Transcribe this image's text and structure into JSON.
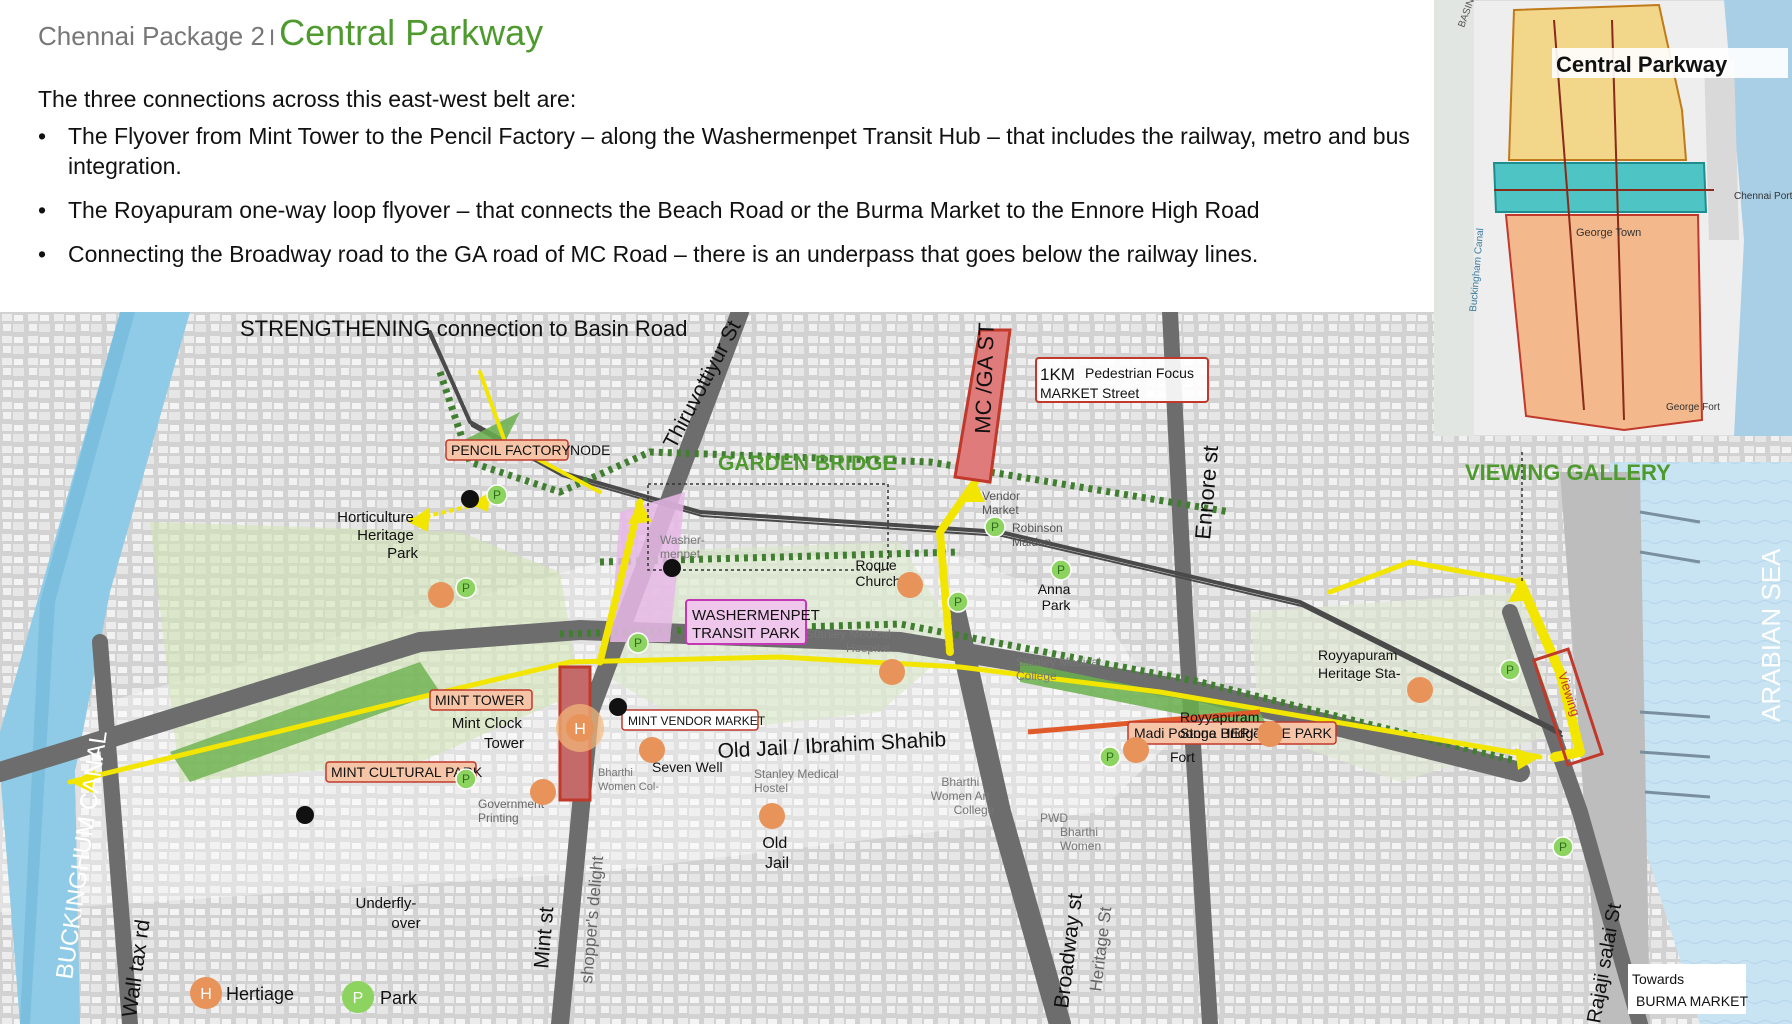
{
  "header": {
    "package": "Chennai Package 2",
    "separator": "I",
    "title": "Central Parkway"
  },
  "intro": "The three connections across this east-west belt are:",
  "bullets": [
    "The Flyover from Mint Tower to the Pencil Factory – along the Washermenpet Transit Hub –  that includes the railway, metro and bus integration.",
    "The Royapuram one-way loop flyover – that connects the Beach Road or the Burma Market to the Ennore High Road",
    "Connecting the Broadway road to the GA road of MC Road – there is an underpass that goes below the railway lines."
  ],
  "map": {
    "top_label": "STRENGTHENING connection to Basin Road",
    "roads": {
      "thiruvottiyur": "Thiruvottiyur St",
      "mc_ga": "MC /GA ST",
      "ennore": "Ennore st",
      "broadway": "Broadway st",
      "heritage_st": "Heritage St",
      "mint": "Mint  st",
      "shoppers": "shopper's delight",
      "wall_tax": "Wall tax rd",
      "rajaji": "Rajaji salai St",
      "old_jail": "Old Jail / Ibrahim Shahib"
    },
    "water": {
      "canal": "BUCKINGHUM CANAL",
      "sea": "ARABIAN SEA"
    },
    "callouts": {
      "garden_bridge": "GARDEN BRIDGE",
      "viewing_gallery": "VIEWING GALLERY",
      "viewing_vertical": "Viewing",
      "market_street_km": "1KM",
      "market_street_1": "Pedestrian Focus",
      "market_street_2": "MARKET Street",
      "pencil_factory": "PENCIL FACTORY",
      "pencil_node": "NODE",
      "washermenpet_1": "WASHERMENPET",
      "washermenpet_2": "TRANSIT PARK",
      "mint_tower": "MINT TOWER",
      "mint_vendor": "MINT VENDOR MARKET",
      "mint_cultural": "MINT CULTURAL PARK",
      "madi_poonga": "Madi Poonga HERITAGE PARK"
    },
    "places": {
      "horticulture": [
        "Horticulture",
        "Heritage",
        "Park"
      ],
      "washermenpet": [
        "Washer-",
        "menpet"
      ],
      "vendor_market": [
        "Vendor",
        "Market"
      ],
      "robinson": [
        "Robinson",
        "Maidan"
      ],
      "roque": [
        "Roque",
        "Church"
      ],
      "anna": [
        "Anna",
        "Park"
      ],
      "stanley_hospital": [
        "Stanley Medical",
        "Hospital"
      ],
      "stanley_college": [
        "Stanley Medical",
        "College"
      ],
      "royyapuram_station": [
        "Royyapuram",
        "Heritage Sta-"
      ],
      "royyapuram_bridge": [
        "Royyapuram",
        "Stone Bridge"
      ],
      "mint_clock": [
        "Mint Clock",
        "Tower"
      ],
      "seven_well": "Seven Well",
      "govt_printing": [
        "Government",
        "Printing"
      ],
      "bharthi_women_col": [
        "Bharthi",
        "Women Col-"
      ],
      "stanley_hostel": [
        "Stanley Medical",
        "Hostel"
      ],
      "old_jail": [
        "Old",
        "Jail"
      ],
      "bharthi_art": [
        "Bharthi",
        "Women Art",
        "College"
      ],
      "pwd": "PWD",
      "bharthi_women": [
        "Bharthi",
        "Women"
      ],
      "fort": "Fort",
      "underflyover": [
        "Underfly-",
        "over"
      ],
      "burma": [
        "Towards",
        "BURMA MARKET"
      ]
    },
    "legend": [
      {
        "symbol": "H",
        "label": "Hertiage",
        "color": "#e8935a"
      },
      {
        "symbol": "P",
        "label": "Park",
        "color": "#8dd35f"
      }
    ],
    "colors": {
      "flyover": "#f2e600",
      "park": "#6ab04c",
      "heritage": "#e8935a",
      "callout_border": "#c0392b",
      "transit": "#e060c0"
    }
  },
  "inset": {
    "title": "Central Parkway",
    "labels": {
      "chennai_port": "Chennai Port",
      "george_town": "George Town",
      "george_fort": "George Fort",
      "basin_road": "BASIN ROAD",
      "buckingham": "Buckingham Canal"
    }
  }
}
